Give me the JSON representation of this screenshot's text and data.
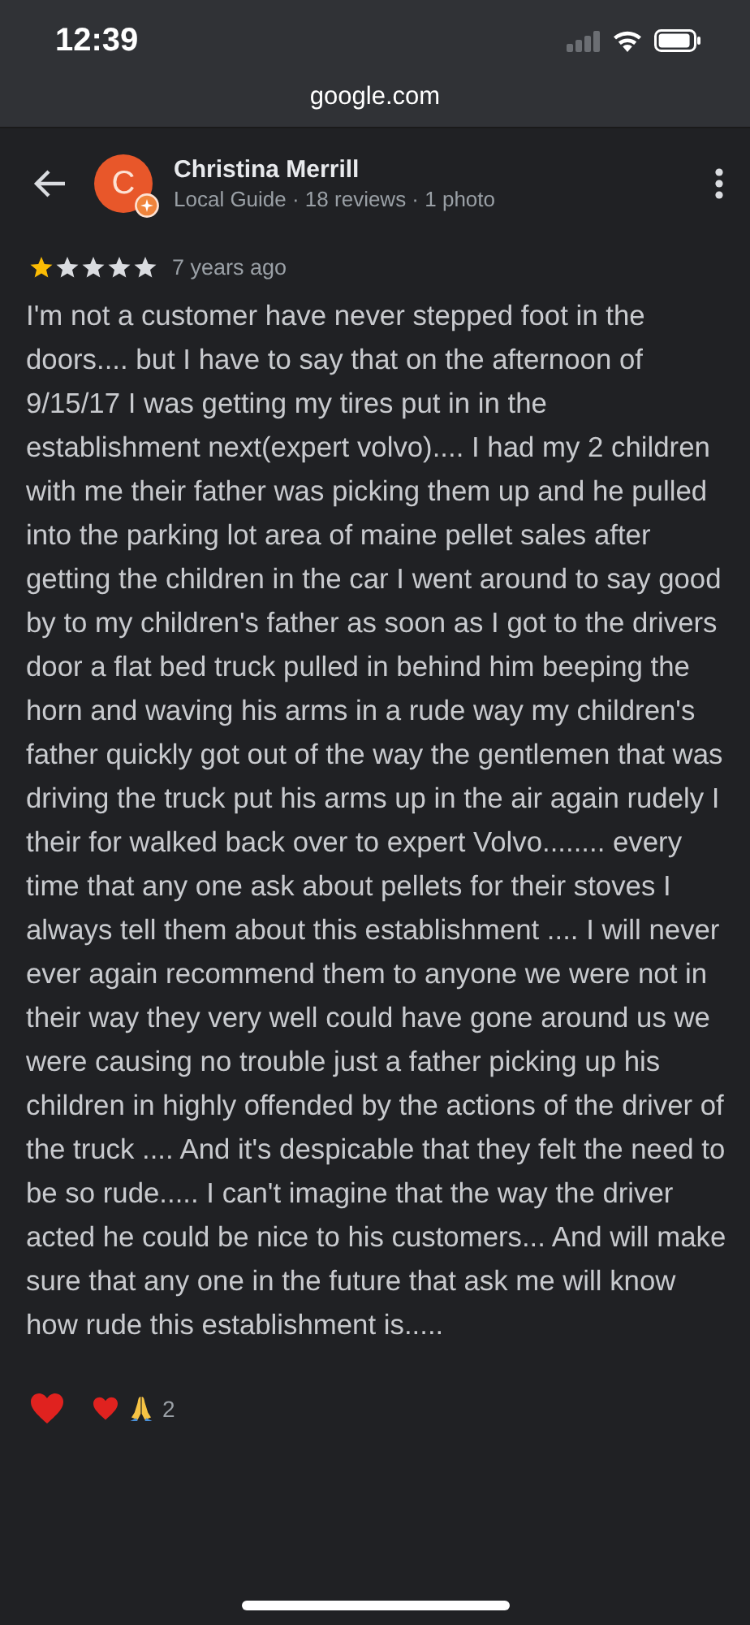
{
  "status_bar": {
    "time": "12:39"
  },
  "address_bar": {
    "url": "google.com"
  },
  "reviewer": {
    "avatar_letter": "C",
    "name": "Christina Merrill",
    "meta": "Local Guide · 18 reviews · 1 photo"
  },
  "review": {
    "stars": 1,
    "time": "7 years ago",
    "text": "I'm not a customer have never stepped foot in the doors.... but I have to say that on the afternoon of 9/15/17 I was getting my tires put in in the establishment next(expert volvo).... I had my 2 children with me their father was picking them up and he pulled into the parking lot area of maine pellet sales after getting the children in the car I went around to say good by to my children's father as soon as I got to the drivers door a flat bed truck pulled in behind him beeping the horn and waving his arms in a rude way my children's father quickly got out of the way the gentlemen that was driving the truck put his arms up in the air again rudely I their for walked back over to expert Volvo........ every time that any one ask about pellets for their stoves I always tell them about this establishment .... I will never ever again recommend them to anyone we were not in their way they very well could have gone around us we were causing no trouble just a father picking up his children in highly offended by the actions of the driver of the truck .... And it's despicable that they felt the need to be so rude..... I can't imagine that the way the driver acted he could be nice to his customers... And will make sure that any one in the future that ask me will know how rude this establishment is....."
  },
  "reactions": {
    "count": "2"
  }
}
